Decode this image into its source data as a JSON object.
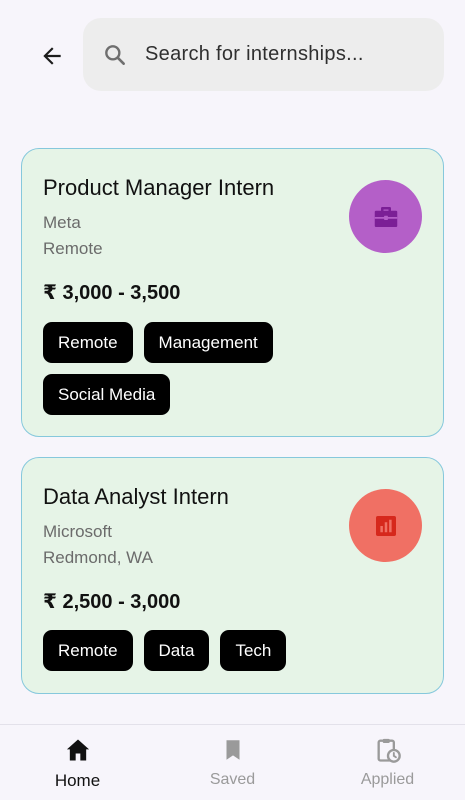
{
  "search": {
    "placeholder": "Search for internships..."
  },
  "icons": {
    "back": "back-arrow-icon",
    "search": "search-icon",
    "briefcase": "briefcase-icon",
    "chart": "bar-chart-icon",
    "home": "home-icon",
    "saved": "bookmark-icon",
    "applied": "clipboard-clock-icon"
  },
  "colors": {
    "card_bg": "#e6f4e7",
    "card_border": "#86c8dc",
    "badge_purple": "#b45fc8",
    "badge_red": "#f07064"
  },
  "internships": [
    {
      "title": "Product Manager Intern",
      "company": "Meta",
      "location": "Remote",
      "stipend": "₹ 3,000 - 3,500",
      "tags": [
        "Remote",
        "Management",
        "Social Media"
      ]
    },
    {
      "title": "Data Analyst Intern",
      "company": "Microsoft",
      "location": "Redmond, WA",
      "stipend": "₹ 2,500 - 3,000",
      "tags": [
        "Remote",
        "Data",
        "Tech"
      ]
    }
  ],
  "nav": {
    "items": [
      {
        "label": "Home",
        "active": true
      },
      {
        "label": "Saved",
        "active": false
      },
      {
        "label": "Applied",
        "active": false
      }
    ]
  }
}
